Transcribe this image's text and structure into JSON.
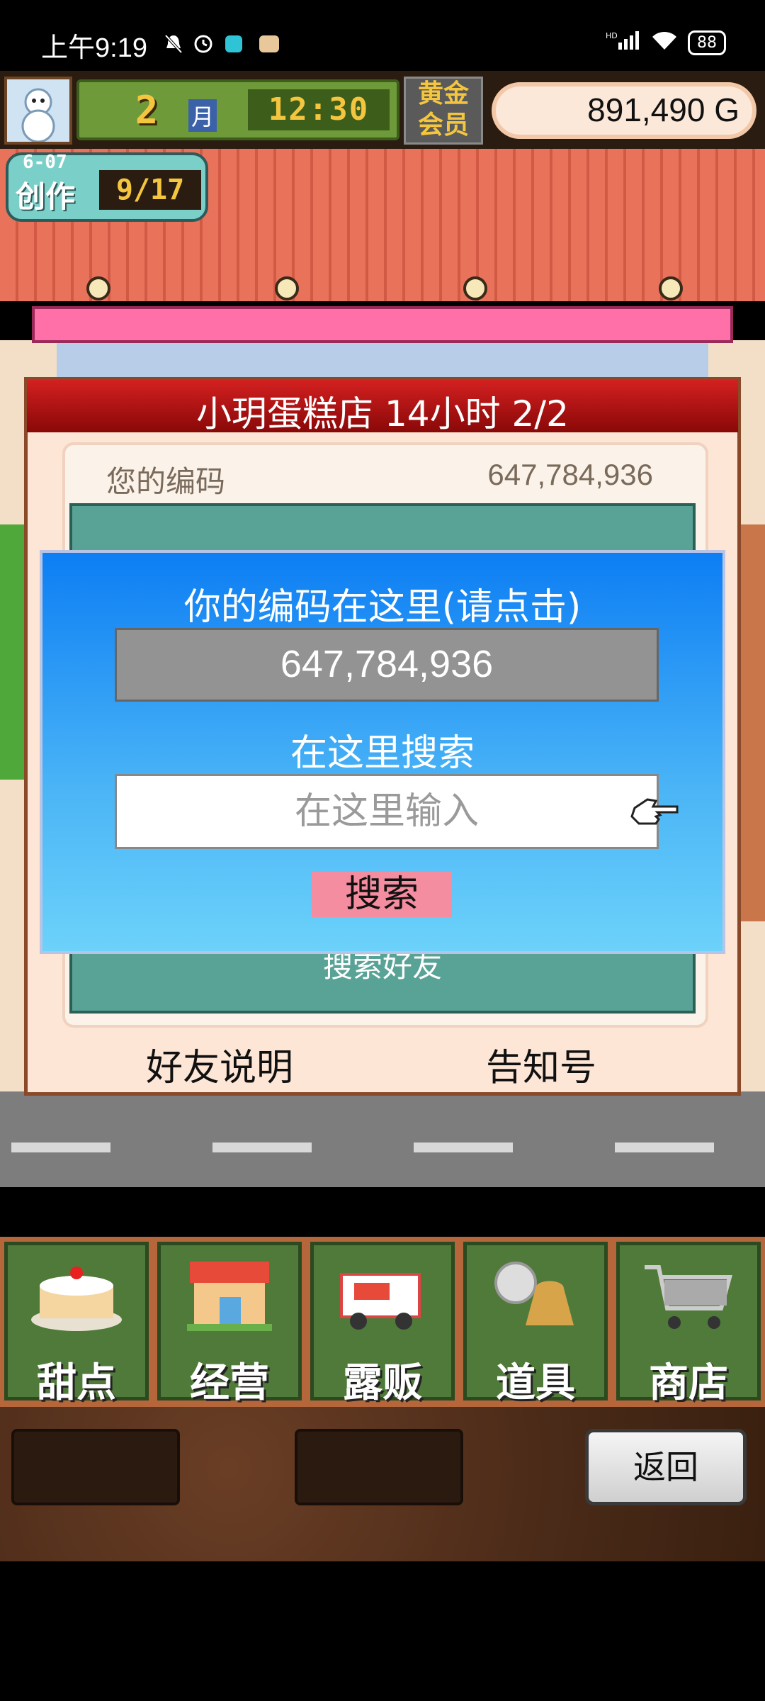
{
  "status_bar": {
    "time": "上午9:19",
    "network": "HD",
    "battery": "88"
  },
  "hud": {
    "month_number": "2",
    "month_label": "月",
    "clock": "12:30",
    "membership": "黄金会员",
    "money": "891,490 G"
  },
  "create_badge": {
    "date": "6-07",
    "label": "创作",
    "progress": "9/17"
  },
  "shop_dialog": {
    "title": "小玥蛋糕店  14小时 2/2",
    "code_label": "您的编码",
    "code_value": "647,784,936",
    "teal_search_text": "搜索好友",
    "friend_description": "好友说明",
    "notice": "告知号"
  },
  "popup": {
    "title": "你的编码在这里(请点击)",
    "code_display": "647,784,936",
    "search_heading": "在这里搜索",
    "search_placeholder": "在这里输入",
    "search_button": "搜索"
  },
  "menu": {
    "items": [
      {
        "label": "甜点",
        "icon": "cake-icon"
      },
      {
        "label": "经营",
        "icon": "shop-icon"
      },
      {
        "label": "露贩",
        "icon": "food-truck-icon"
      },
      {
        "label": "道具",
        "icon": "items-bag-icon"
      },
      {
        "label": "商店",
        "icon": "shopping-cart-icon"
      }
    ]
  },
  "footer": {
    "back_button": "返回"
  },
  "colors": {
    "popup_blue": "#0d7ef4",
    "title_red": "#d42020",
    "menu_green": "#4f7a3a",
    "search_button_pink": "#f58da0"
  }
}
